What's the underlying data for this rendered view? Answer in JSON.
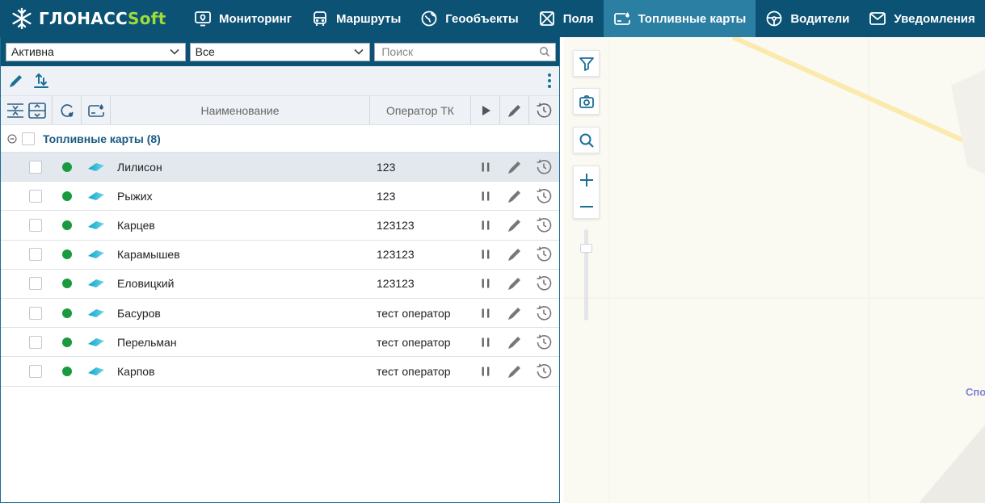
{
  "app": {
    "logo_main": "ГЛОНАСС",
    "logo_accent": "Soft"
  },
  "nav": {
    "monitoring": "Мониторинг",
    "routes": "Маршруты",
    "geoobjects": "Геообъекты",
    "fields": "Поля",
    "fuel_cards": "Топливные карты",
    "drivers": "Водители",
    "notifications": "Уведомления"
  },
  "filters": {
    "status_value": "Активна",
    "scope_value": "Все",
    "search_placeholder": "Поиск"
  },
  "table": {
    "headers": {
      "name": "Наименование",
      "operator": "Оператор ТК"
    },
    "group_label": "Топливные карты (8)",
    "rows": [
      {
        "name": "Лилисон",
        "operator": "123",
        "selected": true
      },
      {
        "name": "Рыжих",
        "operator": "123"
      },
      {
        "name": "Карцев",
        "operator": "123123"
      },
      {
        "name": "Карамышев",
        "operator": "123123"
      },
      {
        "name": "Еловицкий",
        "operator": "123123"
      },
      {
        "name": "Басуров",
        "operator": "тест оператор"
      },
      {
        "name": "Перельман",
        "operator": "тест оператор"
      },
      {
        "name": "Карпов",
        "operator": "тест оператор"
      }
    ]
  },
  "map": {
    "label_partial": "Спо"
  },
  "colors": {
    "header_bg": "#0b5274",
    "active_tab": "#2a7fa3",
    "accent": "#1a6f97",
    "status_active": "#1a9a3e",
    "logo_accent": "#9fdc3a"
  }
}
